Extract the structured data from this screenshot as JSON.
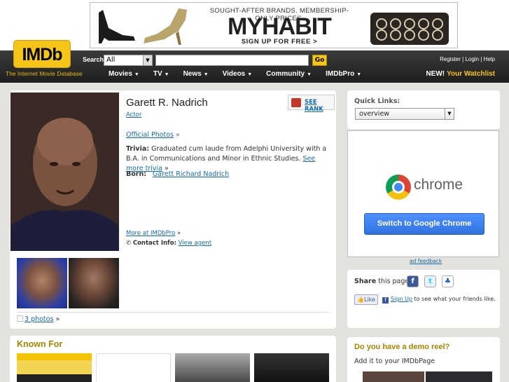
{
  "ad": {
    "tagline": "SOUGHT-AFTER BRANDS. MEMBERSHIP-ONLY PRICES.",
    "brand_my": "MY",
    "brand_habit": "HABIT",
    "cta": "SIGN UP FOR FREE >"
  },
  "header": {
    "logo": "IMDb",
    "logo_sub": "The Internet Movie Database",
    "search_label": "Search",
    "search_category": "All",
    "search_value": "",
    "go_label": "Go",
    "util_links": "Register | Login | Help",
    "menu": [
      {
        "label": "Movies"
      },
      {
        "label": "TV"
      },
      {
        "label": "News"
      },
      {
        "label": "Videos"
      },
      {
        "label": "Community"
      },
      {
        "label": "IMDbPro"
      }
    ],
    "new_label": "NEW!",
    "watchlist_label": "Your Watchlist"
  },
  "profile": {
    "name": "Garett R. Nadrich",
    "role": "Actor",
    "see_rank": "SEE RANK",
    "official_photos": "Official Photos",
    "official_sep": "»",
    "trivia_label": "Trivia:",
    "trivia_text": "Graduated cum laude from Adelphi University with a B.A. in Communications and Minor in Ethnic Studies.",
    "trivia_more": "See more trivia",
    "trivia_more_sep": "»",
    "born_label": "Born:",
    "born_value": "Garett Richard Nadrich",
    "more_imdbpro": "More at IMDbPro",
    "more_imdbpro_sep": "»",
    "contact_label": "Contact Info:",
    "contact_link": "View agent",
    "photos_link": "3 photos",
    "photos_sep": "»"
  },
  "known_for": {
    "title": "Known For"
  },
  "sidebar": {
    "quick_links_label": "Quick Links:",
    "quick_links_value": "overview",
    "chrome_word": "chrome",
    "chrome_button": "Switch to Google Chrome",
    "ad_feedback": "ad feedback",
    "share_bold": "Share",
    "share_rest": " this page:",
    "like_label": "Like",
    "signup_link": "Sign Up",
    "signup_rest": " to see what your friends like.",
    "reel_title": "Do you have a demo reel?",
    "reel_sub": "Add it to your IMDbPage"
  },
  "colors": {
    "imdb_yellow": "#f5c518",
    "link_blue": "#136cb2",
    "section_gold": "#a58500",
    "page_bg": "#e3e2dd"
  }
}
